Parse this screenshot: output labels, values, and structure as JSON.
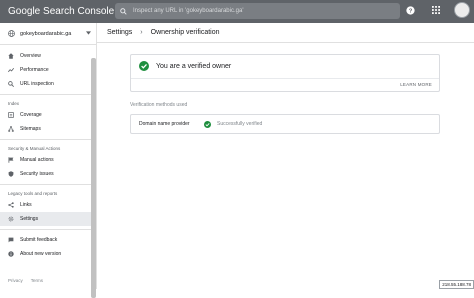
{
  "app": {
    "title": "Google Search Console"
  },
  "search": {
    "placeholder": "Inspect any URL in 'gokeyboardarabic.ga'"
  },
  "property": {
    "name": "gokeyboardarabic.ga"
  },
  "sidebar": {
    "top_items": [
      {
        "label": "Overview",
        "icon": "home-icon"
      },
      {
        "label": "Performance",
        "icon": "trend-icon"
      },
      {
        "label": "URL inspection",
        "icon": "search-icon"
      }
    ],
    "index_label": "Index",
    "index_items": [
      {
        "label": "Coverage",
        "icon": "coverage-icon"
      },
      {
        "label": "Sitemaps",
        "icon": "sitemaps-icon"
      }
    ],
    "security_label": "Security & Manual Actions",
    "security_items": [
      {
        "label": "Manual actions",
        "icon": "flag-icon"
      },
      {
        "label": "Security issues",
        "icon": "shield-icon"
      }
    ],
    "legacy_label": "Legacy tools and reports",
    "legacy_items": [
      {
        "label": "Links",
        "icon": "links-icon"
      },
      {
        "label": "Settings",
        "icon": "gear-icon",
        "active": true
      }
    ],
    "bottom_items": [
      {
        "label": "Submit feedback",
        "icon": "feedback-icon"
      },
      {
        "label": "About new version",
        "icon": "info-icon"
      }
    ],
    "footer": {
      "privacy": "Privacy",
      "terms": "Terms"
    }
  },
  "breadcrumb": {
    "parent": "Settings",
    "current": "Ownership verification"
  },
  "verified_card": {
    "message": "You are a verified owner",
    "learn_more": "LEARN MORE"
  },
  "methods": {
    "label": "Verification methods used",
    "items": [
      {
        "name": "Domain name provider",
        "status": "Successfully verified"
      }
    ]
  },
  "ip_badge": "218.55.188.78",
  "colors": {
    "topbar": "#5f6368",
    "success": "#1e8e3e"
  }
}
